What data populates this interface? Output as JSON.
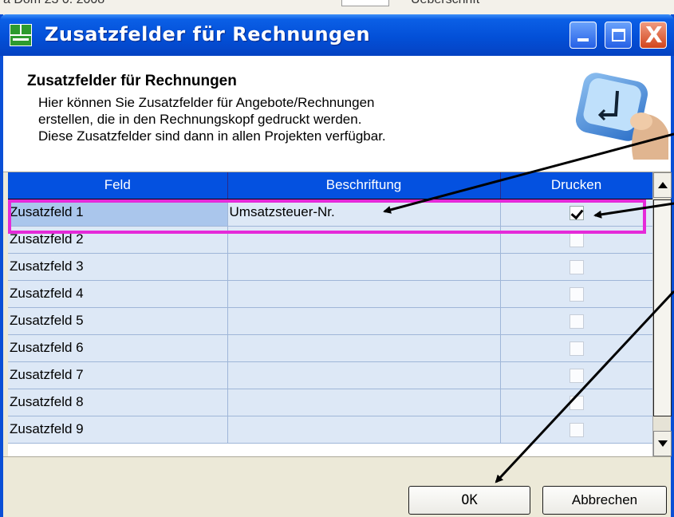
{
  "background": {
    "left_text": "a Dom 23 0. 2008",
    "right_text": "Ueberschrift"
  },
  "window": {
    "title": "Zusatzfelder für Rechnungen",
    "minimize_label": "",
    "maximize_label": "",
    "close_label": "X"
  },
  "header": {
    "title": "Zusatzfelder für Rechnungen",
    "lines": [
      "Hier können Sie Zusatzfelder für Angebote/Rechnungen",
      "erstellen, die in den Rechnungskopf gedruckt werden.",
      "Diese Zusatzfelder sind dann in allen Projekten verfügbar."
    ]
  },
  "grid": {
    "columns": [
      "Feld",
      "Beschriftung",
      "Drucken"
    ],
    "rows": [
      {
        "feld": "Zusatzfeld 1",
        "beschriftung": "Umsatzsteuer-Nr.",
        "drucken": true
      },
      {
        "feld": "Zusatzfeld 2",
        "beschriftung": "",
        "drucken": false
      },
      {
        "feld": "Zusatzfeld 3",
        "beschriftung": "",
        "drucken": false
      },
      {
        "feld": "Zusatzfeld 4",
        "beschriftung": "",
        "drucken": false
      },
      {
        "feld": "Zusatzfeld 5",
        "beschriftung": "",
        "drucken": false
      },
      {
        "feld": "Zusatzfeld 6",
        "beschriftung": "",
        "drucken": false
      },
      {
        "feld": "Zusatzfeld 7",
        "beschriftung": "",
        "drucken": false
      },
      {
        "feld": "Zusatzfeld 8",
        "beschriftung": "",
        "drucken": false
      },
      {
        "feld": "Zusatzfeld 9",
        "beschriftung": "",
        "drucken": false
      }
    ]
  },
  "buttons": {
    "ok": "OK",
    "cancel": "Abbrechen"
  },
  "colors": {
    "titlebar": "#0350d8",
    "grid_header": "#0451e0",
    "row_background": "#dde8f6",
    "selected_cell": "#aac6ec",
    "highlight_box": "#e52ad9"
  }
}
